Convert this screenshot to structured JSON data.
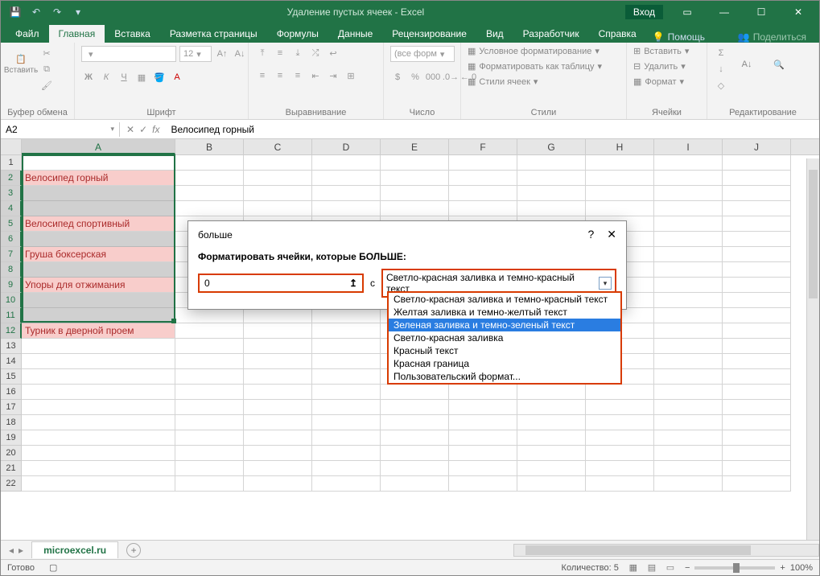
{
  "titlebar": {
    "title": "Удаление пустых ячеек  -  Excel",
    "signin": "Вход"
  },
  "tabs": {
    "file": "Файл",
    "list": [
      "Главная",
      "Вставка",
      "Разметка страницы",
      "Формулы",
      "Данные",
      "Рецензирование",
      "Вид",
      "Разработчик",
      "Справка"
    ],
    "active": 0,
    "tell": "Помощь",
    "share": "Поделиться"
  },
  "ribbon_groups": {
    "clipboard": "Буфер обмена",
    "font": "Шрифт",
    "alignment": "Выравнивание",
    "number": "Число",
    "styles": "Стили",
    "cells": "Ячейки",
    "editing": "Редактирование",
    "paste": "Вставить",
    "font_size": "12",
    "number_fmt": "(все форм",
    "cond_fmt": "Условное форматирование",
    "table_fmt": "Форматировать как таблицу",
    "cell_styles": "Стили ячеек",
    "insert": "Вставить",
    "delete": "Удалить",
    "format": "Формат"
  },
  "namebox": "A2",
  "formula": "Велосипед горный",
  "columns": [
    "A",
    "B",
    "C",
    "D",
    "E",
    "F",
    "G",
    "H",
    "I",
    "J"
  ],
  "col_widths": {
    "A": 191,
    "other": 85
  },
  "rows_visible": 22,
  "data_cells": [
    {
      "row": 2,
      "text": "Велосипед горный",
      "cls": "red"
    },
    {
      "row": 3,
      "text": "",
      "cls": "gray"
    },
    {
      "row": 4,
      "text": "",
      "cls": "gray"
    },
    {
      "row": 5,
      "text": "Велосипед спортивный",
      "cls": "red"
    },
    {
      "row": 6,
      "text": "",
      "cls": "gray"
    },
    {
      "row": 7,
      "text": "Груша боксерская",
      "cls": "red"
    },
    {
      "row": 8,
      "text": "",
      "cls": "gray"
    },
    {
      "row": 9,
      "text": "Упоры для отжимания",
      "cls": "red"
    },
    {
      "row": 10,
      "text": "",
      "cls": "gray"
    },
    {
      "row": 11,
      "text": "",
      "cls": "gray"
    },
    {
      "row": 12,
      "text": "Турник в дверной проем",
      "cls": "red"
    }
  ],
  "dialog": {
    "title": "больше",
    "label": "Форматировать ячейки, которые БОЛЬШЕ:",
    "value": "0",
    "with": "с",
    "selected": "Светло-красная заливка и темно-красный текст",
    "options": [
      "Светло-красная заливка и темно-красный текст",
      "Желтая заливка и темно-желтый текст",
      "Зеленая заливка и темно-зеленый текст",
      "Светло-красная заливка",
      "Красный текст",
      "Красная граница",
      "Пользовательский формат..."
    ],
    "highlight": 2
  },
  "sheet_tab": "microexcel.ru",
  "statusbar": {
    "ready": "Готово",
    "count_label": "Количество:",
    "count": "5",
    "zoom": "100%"
  }
}
